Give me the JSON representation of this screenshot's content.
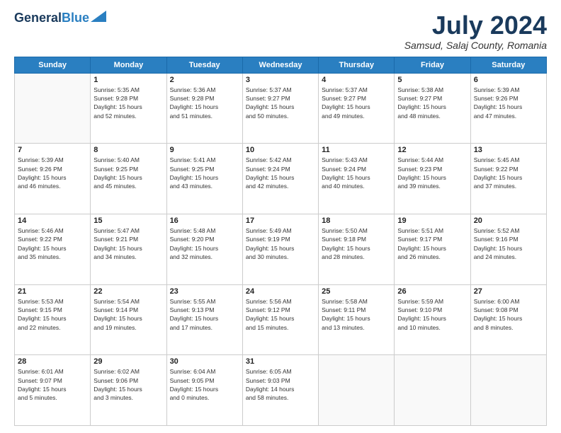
{
  "header": {
    "logo_line1": "General",
    "logo_line2": "Blue",
    "month": "July 2024",
    "location": "Samsud, Salaj County, Romania"
  },
  "weekdays": [
    "Sunday",
    "Monday",
    "Tuesday",
    "Wednesday",
    "Thursday",
    "Friday",
    "Saturday"
  ],
  "weeks": [
    [
      {
        "day": null,
        "info": null
      },
      {
        "day": "1",
        "info": "Sunrise: 5:35 AM\nSunset: 9:28 PM\nDaylight: 15 hours\nand 52 minutes."
      },
      {
        "day": "2",
        "info": "Sunrise: 5:36 AM\nSunset: 9:28 PM\nDaylight: 15 hours\nand 51 minutes."
      },
      {
        "day": "3",
        "info": "Sunrise: 5:37 AM\nSunset: 9:27 PM\nDaylight: 15 hours\nand 50 minutes."
      },
      {
        "day": "4",
        "info": "Sunrise: 5:37 AM\nSunset: 9:27 PM\nDaylight: 15 hours\nand 49 minutes."
      },
      {
        "day": "5",
        "info": "Sunrise: 5:38 AM\nSunset: 9:27 PM\nDaylight: 15 hours\nand 48 minutes."
      },
      {
        "day": "6",
        "info": "Sunrise: 5:39 AM\nSunset: 9:26 PM\nDaylight: 15 hours\nand 47 minutes."
      }
    ],
    [
      {
        "day": "7",
        "info": "Sunrise: 5:39 AM\nSunset: 9:26 PM\nDaylight: 15 hours\nand 46 minutes."
      },
      {
        "day": "8",
        "info": "Sunrise: 5:40 AM\nSunset: 9:25 PM\nDaylight: 15 hours\nand 45 minutes."
      },
      {
        "day": "9",
        "info": "Sunrise: 5:41 AM\nSunset: 9:25 PM\nDaylight: 15 hours\nand 43 minutes."
      },
      {
        "day": "10",
        "info": "Sunrise: 5:42 AM\nSunset: 9:24 PM\nDaylight: 15 hours\nand 42 minutes."
      },
      {
        "day": "11",
        "info": "Sunrise: 5:43 AM\nSunset: 9:24 PM\nDaylight: 15 hours\nand 40 minutes."
      },
      {
        "day": "12",
        "info": "Sunrise: 5:44 AM\nSunset: 9:23 PM\nDaylight: 15 hours\nand 39 minutes."
      },
      {
        "day": "13",
        "info": "Sunrise: 5:45 AM\nSunset: 9:22 PM\nDaylight: 15 hours\nand 37 minutes."
      }
    ],
    [
      {
        "day": "14",
        "info": "Sunrise: 5:46 AM\nSunset: 9:22 PM\nDaylight: 15 hours\nand 35 minutes."
      },
      {
        "day": "15",
        "info": "Sunrise: 5:47 AM\nSunset: 9:21 PM\nDaylight: 15 hours\nand 34 minutes."
      },
      {
        "day": "16",
        "info": "Sunrise: 5:48 AM\nSunset: 9:20 PM\nDaylight: 15 hours\nand 32 minutes."
      },
      {
        "day": "17",
        "info": "Sunrise: 5:49 AM\nSunset: 9:19 PM\nDaylight: 15 hours\nand 30 minutes."
      },
      {
        "day": "18",
        "info": "Sunrise: 5:50 AM\nSunset: 9:18 PM\nDaylight: 15 hours\nand 28 minutes."
      },
      {
        "day": "19",
        "info": "Sunrise: 5:51 AM\nSunset: 9:17 PM\nDaylight: 15 hours\nand 26 minutes."
      },
      {
        "day": "20",
        "info": "Sunrise: 5:52 AM\nSunset: 9:16 PM\nDaylight: 15 hours\nand 24 minutes."
      }
    ],
    [
      {
        "day": "21",
        "info": "Sunrise: 5:53 AM\nSunset: 9:15 PM\nDaylight: 15 hours\nand 22 minutes."
      },
      {
        "day": "22",
        "info": "Sunrise: 5:54 AM\nSunset: 9:14 PM\nDaylight: 15 hours\nand 19 minutes."
      },
      {
        "day": "23",
        "info": "Sunrise: 5:55 AM\nSunset: 9:13 PM\nDaylight: 15 hours\nand 17 minutes."
      },
      {
        "day": "24",
        "info": "Sunrise: 5:56 AM\nSunset: 9:12 PM\nDaylight: 15 hours\nand 15 minutes."
      },
      {
        "day": "25",
        "info": "Sunrise: 5:58 AM\nSunset: 9:11 PM\nDaylight: 15 hours\nand 13 minutes."
      },
      {
        "day": "26",
        "info": "Sunrise: 5:59 AM\nSunset: 9:10 PM\nDaylight: 15 hours\nand 10 minutes."
      },
      {
        "day": "27",
        "info": "Sunrise: 6:00 AM\nSunset: 9:08 PM\nDaylight: 15 hours\nand 8 minutes."
      }
    ],
    [
      {
        "day": "28",
        "info": "Sunrise: 6:01 AM\nSunset: 9:07 PM\nDaylight: 15 hours\nand 5 minutes."
      },
      {
        "day": "29",
        "info": "Sunrise: 6:02 AM\nSunset: 9:06 PM\nDaylight: 15 hours\nand 3 minutes."
      },
      {
        "day": "30",
        "info": "Sunrise: 6:04 AM\nSunset: 9:05 PM\nDaylight: 15 hours\nand 0 minutes."
      },
      {
        "day": "31",
        "info": "Sunrise: 6:05 AM\nSunset: 9:03 PM\nDaylight: 14 hours\nand 58 minutes."
      },
      {
        "day": null,
        "info": null
      },
      {
        "day": null,
        "info": null
      },
      {
        "day": null,
        "info": null
      }
    ]
  ]
}
